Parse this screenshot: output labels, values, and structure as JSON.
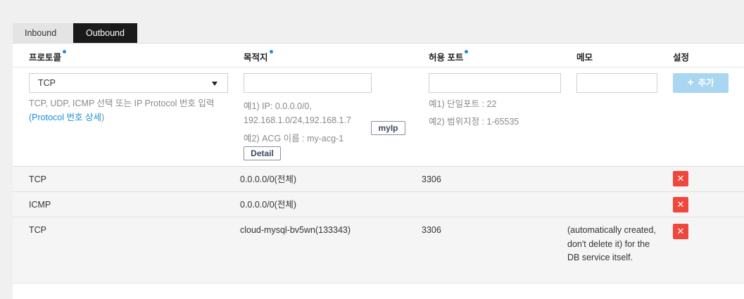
{
  "tabs": {
    "inbound": "Inbound",
    "outbound": "Outbound"
  },
  "header": {
    "protocol": "프로토콜",
    "destination": "목적지",
    "port": "허용 포트",
    "memo": "메모",
    "settings": "설정"
  },
  "form": {
    "protocol_value": "TCP",
    "protocol_hint": "TCP, UDP, ICMP 선택 또는 IP Protocol 번호 입력",
    "protocol_link_open": "(",
    "protocol_link": "Protocol 번호 상세",
    "protocol_link_close": ")",
    "dest_hint1_line1": "예1) IP: 0.0.0.0/0,",
    "dest_hint1_line2": "192.168.1.0/24,192.168.1.7",
    "dest_hint2": "예2) ACG 이름 : my-acg-1",
    "myip_label": "myIp",
    "detail_label": "Detail",
    "port_hint1": "예1) 단일포트 : 22",
    "port_hint2": "예2) 범위지정 : 1-65535",
    "add_label": "추가",
    "add_icon": "plus-icon"
  },
  "rules": [
    {
      "protocol": "TCP",
      "destination": "0.0.0.0/0(전체)",
      "port": "3306",
      "memo": ""
    },
    {
      "protocol": "ICMP",
      "destination": "0.0.0.0/0(전체)",
      "port": "",
      "memo": ""
    },
    {
      "protocol": "TCP",
      "destination": "cloud-mysql-bv5wn(133343)",
      "port": "3306",
      "memo": "(automatically created, don't delete it) for the DB service itself."
    }
  ],
  "colors": {
    "accent": "#1a8fd6",
    "delete": "#f0473c",
    "add_disabled": "#a9d6f1",
    "active_tab": "#1a1a1a"
  }
}
